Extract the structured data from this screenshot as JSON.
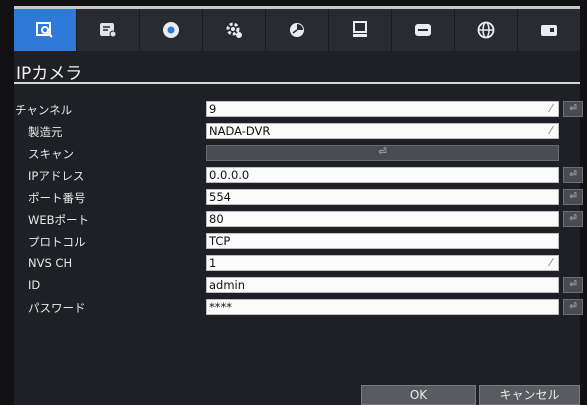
{
  "toolbar": {
    "icons": [
      "camera-search-icon",
      "record-settings-icon",
      "record-icon",
      "settings-gear-icon",
      "schedule-clock-icon",
      "network-computer-icon",
      "display-icon",
      "globe-icon",
      "system-icon"
    ],
    "active_index": 0
  },
  "dialog": {
    "title": "IPカメラ",
    "ok_label": "OK",
    "cancel_label": "キャンセル",
    "scan_symbol": "⏎",
    "apply_symbol": "⏎",
    "edit_symbol": "⁄"
  },
  "fields": {
    "channel": {
      "label": "チャンネル",
      "value": "9"
    },
    "maker": {
      "label": "製造元",
      "value": "NADA-DVR"
    },
    "scan": {
      "label": "スキャン"
    },
    "ip": {
      "label": "IPアドレス",
      "value": "0.0.0.0"
    },
    "port": {
      "label": "ポート番号",
      "value": "554"
    },
    "web_port": {
      "label": "WEBポート",
      "value": "80"
    },
    "protocol": {
      "label": "プロトコル",
      "value": "TCP"
    },
    "nvs_ch": {
      "label": "NVS CH",
      "value": "1"
    },
    "id": {
      "label": "ID",
      "value": "admin"
    },
    "password": {
      "label": "パスワード",
      "value": "****"
    }
  }
}
